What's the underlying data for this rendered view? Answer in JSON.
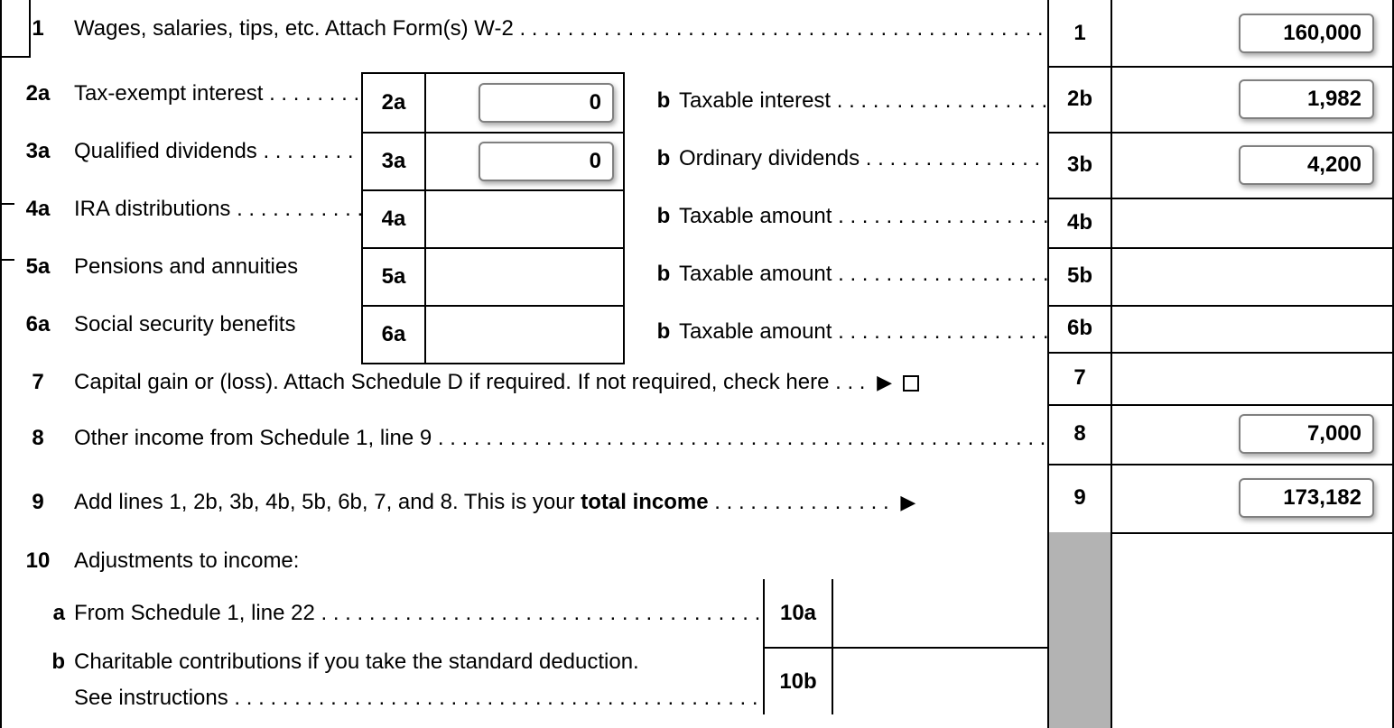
{
  "lines": {
    "l1": {
      "num": "1",
      "label": "Wages, salaries, tips, etc. Attach Form(s) W-2",
      "rnum": "1",
      "amount": "160,000"
    },
    "l2a": {
      "num": "2a",
      "label": "Tax-exempt interest",
      "mid_num": "2a",
      "mid_val": "0",
      "b_label": "Taxable interest",
      "rnum": "2b",
      "amount": "1,982"
    },
    "l3a": {
      "num": "3a",
      "label": "Qualified dividends",
      "mid_num": "3a",
      "mid_val": "0",
      "b_label": "Ordinary dividends",
      "rnum": "3b",
      "amount": "4,200"
    },
    "l4a": {
      "num": "4a",
      "label": "IRA distributions",
      "mid_num": "4a",
      "mid_val": "",
      "b_label": "Taxable amount",
      "rnum": "4b",
      "amount": ""
    },
    "l5a": {
      "num": "5a",
      "label": "Pensions and annuities",
      "mid_num": "5a",
      "mid_val": "",
      "b_label": "Taxable amount",
      "rnum": "5b",
      "amount": ""
    },
    "l6a": {
      "num": "6a",
      "label": "Social security benefits",
      "mid_num": "6a",
      "mid_val": "",
      "b_label": "Taxable amount",
      "rnum": "6b",
      "amount": ""
    },
    "l7": {
      "num": "7",
      "label": "Capital gain or (loss). Attach Schedule D if required. If not required, check here",
      "rnum": "7",
      "amount": ""
    },
    "l8": {
      "num": "8",
      "label": "Other income from Schedule 1, line 9",
      "rnum": "8",
      "amount": "7,000"
    },
    "l9": {
      "num": "9",
      "label_pre": "Add lines 1, 2b, 3b, 4b, 5b, 6b, 7, and 8. This is your ",
      "label_bold": "total income",
      "rnum": "9",
      "amount": "173,182"
    },
    "l10": {
      "num": "10",
      "label": "Adjustments to income:"
    },
    "l10a": {
      "num": "a",
      "label": "From Schedule 1, line 22",
      "snum": "10a"
    },
    "l10b": {
      "num": "b",
      "label_1": "Charitable contributions if you take the standard deduction.",
      "label_2": "See instructions",
      "snum": "10b"
    }
  },
  "b_letter": "b",
  "arrow": "▶"
}
